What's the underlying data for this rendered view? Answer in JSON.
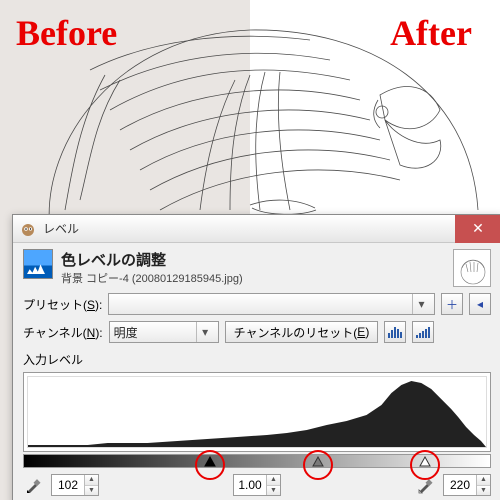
{
  "overlay": {
    "before": "Before",
    "after": "After"
  },
  "window": {
    "title": "レベル",
    "close_label": "✕"
  },
  "header": {
    "title": "色レベルの調整",
    "subtitle": "背景 コピー-4 (20080129185945.jpg)"
  },
  "preset": {
    "label_pre": "プリセット(",
    "label_key": "S",
    "label_post": "):",
    "value": "",
    "add_icon": "＋",
    "menu_icon": "◂"
  },
  "channel": {
    "label_pre": "チャンネル(",
    "label_key": "N",
    "label_post": "):",
    "value": "明度",
    "reset_pre": "チャンネルのリセット(",
    "reset_key": "E",
    "reset_post": ")"
  },
  "input_levels": {
    "label": "入力レベル",
    "black": 102,
    "gamma": "1.00",
    "white": 220,
    "black_pct": 40,
    "gamma_pct": 63,
    "white_pct": 86
  },
  "icons": {
    "linear": "linear-histogram-icon",
    "log": "log-histogram-icon",
    "eyedrop_black": "eyedropper-black-icon",
    "eyedrop_white": "eyedropper-white-icon"
  }
}
